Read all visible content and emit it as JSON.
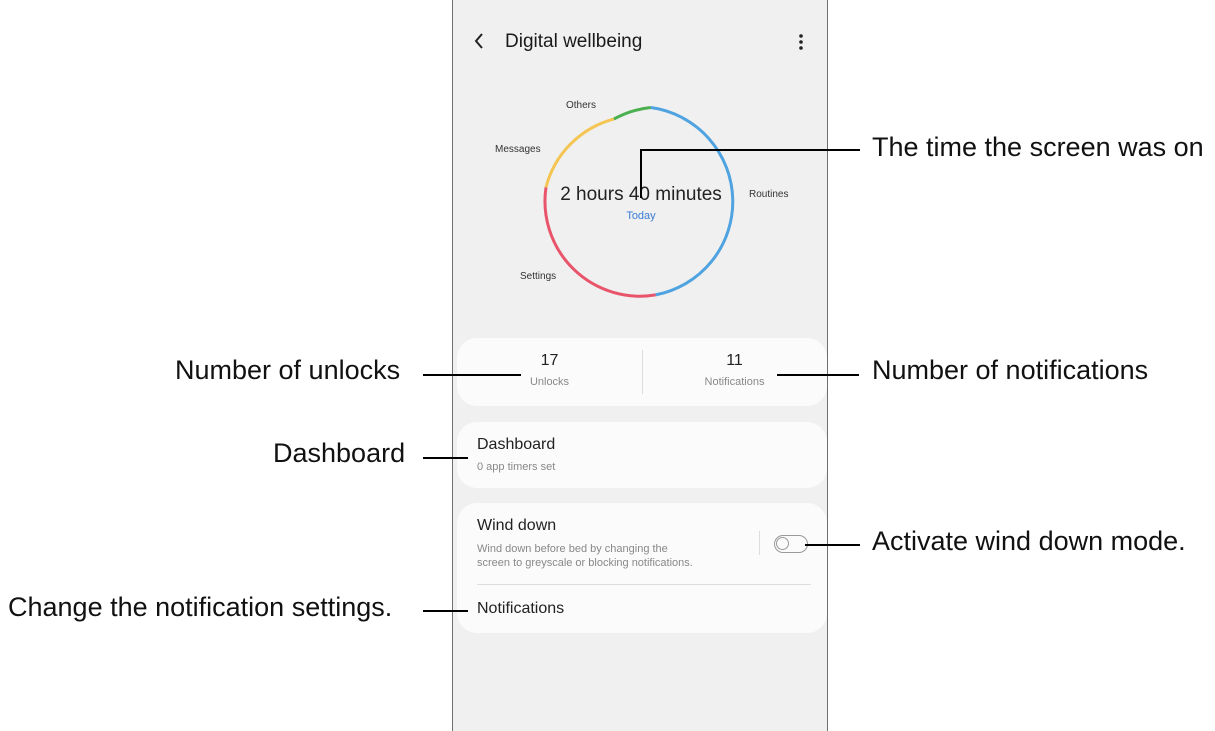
{
  "app": {
    "title": "Digital wellbeing",
    "back_icon": "chevron-left-icon",
    "more_icon": "more-vertical-icon"
  },
  "usage": {
    "screen_time": "2 hours 40 minutes",
    "period": "Today",
    "segments": [
      {
        "name": "Others",
        "color": "#4caf50"
      },
      {
        "name": "Messages",
        "color": "#f4c552"
      },
      {
        "name": "Settings",
        "color": "#e8546a"
      },
      {
        "name": "Routines",
        "color": "#4ea3e0"
      }
    ]
  },
  "stats": {
    "unlocks": {
      "value": "17",
      "label": "Unlocks"
    },
    "notifications": {
      "value": "11",
      "label": "Notifications"
    }
  },
  "dashboard": {
    "title": "Dashboard",
    "subtitle": "0 app timers set"
  },
  "wind_down": {
    "title": "Wind down",
    "description_line1": "Wind down before bed by changing the",
    "description_line2": "screen to greyscale or blocking notifications.",
    "enabled": false
  },
  "notifications_item": {
    "label": "Notifications"
  },
  "annotations": {
    "screen_time": "The time the screen was on",
    "unlocks": "Number of unlocks",
    "notifications": "Number of notifications",
    "dashboard": "Dashboard",
    "wind_down": "Activate wind down mode.",
    "notification_settings": "Change the notification settings."
  }
}
